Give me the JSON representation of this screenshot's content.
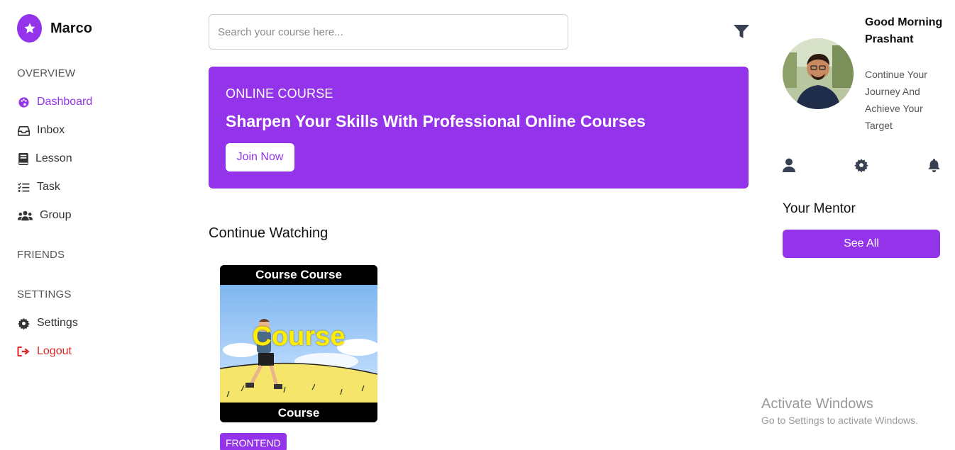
{
  "brand": {
    "name": "Marco",
    "logo_icon": "star-icon"
  },
  "sidebar": {
    "overview_label": "OVERVIEW",
    "items": [
      {
        "label": "Dashboard",
        "icon": "palette-icon",
        "active": true
      },
      {
        "label": "Inbox",
        "icon": "inbox-icon"
      },
      {
        "label": "Lesson",
        "icon": "book-icon"
      },
      {
        "label": "Task",
        "icon": "checklist-icon"
      },
      {
        "label": "Group",
        "icon": "users-icon"
      }
    ],
    "friends_label": "FRIENDS",
    "settings_label": "SETTINGS",
    "settings_item": {
      "label": "Settings",
      "icon": "gear-icon"
    },
    "logout_item": {
      "label": "Logout",
      "icon": "sign-out-icon"
    }
  },
  "search": {
    "placeholder": "Search your course here...",
    "value": "",
    "filter_icon": "filter-icon"
  },
  "banner": {
    "tag": "ONLINE COURSE",
    "title": "Sharpen Your Skills With Professional Online Courses",
    "button_label": "Join Now"
  },
  "continue_watching": {
    "heading": "Continue Watching",
    "courses": [
      {
        "thumb_top": "Course Course",
        "thumb_word": "Course",
        "thumb_bottom": "Course",
        "badge": "FRONTEND"
      }
    ]
  },
  "profile": {
    "greeting": "Good Morning Prashant",
    "subtitle": "Continue Your Journey And Achieve Your Target",
    "icons": [
      "user-icon",
      "gear-icon",
      "bell-icon"
    ]
  },
  "mentor": {
    "heading": "Your Mentor",
    "button_label": "See All"
  },
  "watermark": {
    "title": "Activate Windows",
    "subtitle": "Go to Settings to activate Windows."
  },
  "colors": {
    "accent": "#9333ea",
    "danger": "#dc2626",
    "text": "#333333",
    "muted": "#555555"
  }
}
